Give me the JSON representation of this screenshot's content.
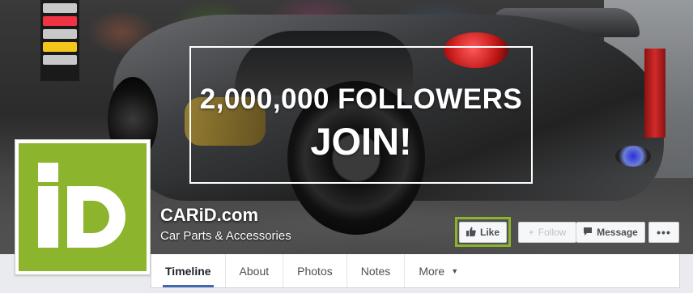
{
  "cover": {
    "promo_headline": "2,000,000 FOLLOWERS",
    "promo_cta": "JOIN!"
  },
  "page": {
    "name": "CARiD.com",
    "category": "Car Parts & Accessories",
    "avatar_logo": "iD"
  },
  "actions": {
    "like_label": "Like",
    "follow_label": "Follow",
    "message_label": "Message",
    "more_label": "•••"
  },
  "icons": {
    "like": "thumbs-up-icon",
    "follow": "plus-icon",
    "message": "message-bubble-icon",
    "more": "ellipsis-icon",
    "more_tab": "caret-down-icon"
  },
  "tabs": [
    {
      "label": "Timeline",
      "active": true
    },
    {
      "label": "About"
    },
    {
      "label": "Photos"
    },
    {
      "label": "Notes"
    },
    {
      "label": "More"
    }
  ],
  "colors": {
    "brand_green": "#8cb42c",
    "active_tab_underline": "#4267b2"
  }
}
